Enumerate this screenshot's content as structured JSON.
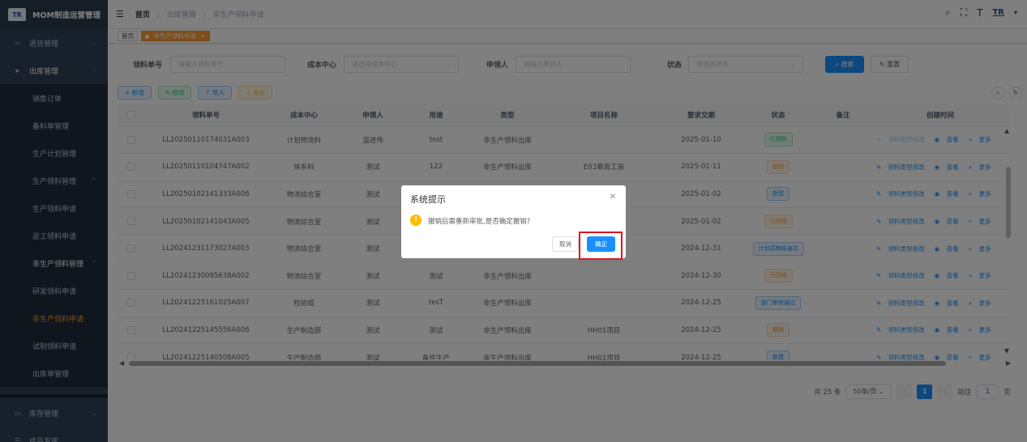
{
  "app": {
    "title": "MOM制造运营管理",
    "logo_text": "TR"
  },
  "sidebar": {
    "items": [
      {
        "label": "退货管理",
        "icon": "return-icon",
        "level": 1
      },
      {
        "label": "出库管理",
        "icon": "send-icon",
        "level": 1
      },
      {
        "label": "销售订单",
        "level": 2
      },
      {
        "label": "备料单管理",
        "level": 2
      },
      {
        "label": "生产计划管理",
        "level": 2
      },
      {
        "label": "生产领料管理",
        "level": 2
      },
      {
        "label": "生产领料申请",
        "level": 3
      },
      {
        "label": "返工领料申请",
        "level": 3
      },
      {
        "label": "非生产领料管理",
        "level": 2
      },
      {
        "label": "研发领料申请",
        "level": 3
      },
      {
        "label": "非生产领料申请",
        "level": 3
      },
      {
        "label": "试制领料申请",
        "level": 3
      },
      {
        "label": "出库单管理",
        "level": 2
      },
      {
        "label": "库存管理",
        "icon": "monitor-icon",
        "level": 1
      },
      {
        "label": "成品发库",
        "icon": "list-icon",
        "level": 1
      }
    ]
  },
  "breadcrumb": {
    "home": "首页",
    "sep": "/",
    "level1": "出库管理",
    "level2": "非生产领料申请"
  },
  "nav_logo": "TR",
  "tags": {
    "home": "首页",
    "active": "非生产领料申请",
    "close": "×"
  },
  "filter": {
    "order_no_label": "领料单号",
    "order_no_placeholder": "请输入领料单号",
    "cost_center_label": "成本中心",
    "cost_center_placeholder": "请选择成本中心",
    "applicant_label": "申领人",
    "applicant_placeholder": "请输入申领人",
    "status_label": "状态",
    "status_placeholder": "请选择状态",
    "search_label": "搜索",
    "reset_label": "重置"
  },
  "toolbar": {
    "add": "+ 新增",
    "edit": "修改",
    "import": "导入",
    "export": "导出"
  },
  "table": {
    "headers": [
      "领料单号",
      "成本中心",
      "申领人",
      "用途",
      "类型",
      "项目名称",
      "要求交期",
      "状态",
      "备注",
      "创建时间"
    ],
    "rows": [
      {
        "no": "LL20250110174031A003",
        "center": "计划物流科",
        "applicant": "温进伟",
        "purpose": "test",
        "type": "非生产领料出库",
        "project": "",
        "date": "2025-01-10",
        "status": "已到料",
        "status_color": "green",
        "edit_disabled": true
      },
      {
        "no": "LL20250110104747A002",
        "center": "体系科",
        "applicant": "测试",
        "purpose": "122",
        "type": "非生产领料出库",
        "project": "E03靠背工装",
        "date": "2025-01-11",
        "status": "撤销",
        "status_color": "orange",
        "edit_disabled": false
      },
      {
        "no": "LL20250102141333A006",
        "center": "物流综合室",
        "applicant": "测试",
        "purpose": "",
        "type": "",
        "project": "",
        "date": "2025-01-02",
        "status": "新建",
        "status_color": "blue",
        "edit_disabled": false
      },
      {
        "no": "LL20250102141043A005",
        "center": "物流综合室",
        "applicant": "测试",
        "purpose": "",
        "type": "",
        "project": "",
        "date": "2025-01-02",
        "status": "已冻结",
        "status_color": "orange",
        "edit_disabled": false
      },
      {
        "no": "LL20241231173027A003",
        "center": "物流综合室",
        "applicant": "测试",
        "purpose": "",
        "type": "",
        "project": "",
        "date": "2024-12-31",
        "status": "计划员审核通过",
        "status_color": "blue",
        "edit_disabled": false
      },
      {
        "no": "LL20241230095638A002",
        "center": "物流综合室",
        "applicant": "测试",
        "purpose": "测试",
        "type": "非生产领料出库",
        "project": "",
        "date": "2024-12-30",
        "status": "已冻结",
        "status_color": "orange",
        "edit_disabled": false
      },
      {
        "no": "LL20241225161025A007",
        "center": "检验组",
        "applicant": "测试",
        "purpose": "tesT",
        "type": "非生产领料出库",
        "project": "",
        "date": "2024-12-25",
        "status": "部门审核通过",
        "status_color": "blue",
        "edit_disabled": false
      },
      {
        "no": "LL20241225145556A006",
        "center": "生产制造部",
        "applicant": "测试",
        "purpose": "测试",
        "type": "非生产领料出库",
        "project": "HH01项目",
        "date": "2024-12-25",
        "status": "撤销",
        "status_color": "orange",
        "edit_disabled": false
      },
      {
        "no": "LL20241225140508A005",
        "center": "生产制造部",
        "applicant": "测试",
        "purpose": "备件生产",
        "type": "非生产领料出库",
        "project": "HH01项目",
        "date": "2024-12-25",
        "status": "新建",
        "status_color": "blue",
        "edit_disabled": false
      }
    ],
    "ops": {
      "type_edit": "领料类型修改",
      "view": "查看",
      "more": "更多"
    }
  },
  "pagination": {
    "total": "共 25 条",
    "page_size": "50条/页",
    "current": "1",
    "goto": "前往",
    "goto_value": "1",
    "page_unit": "页"
  },
  "dialog": {
    "title": "系统提示",
    "message": "撤销后需重新审批,是否确定撤销?",
    "cancel": "取消",
    "confirm": "确定"
  },
  "colors": {
    "accent": "#1890ff",
    "sidebar_bg": "#304156",
    "active_menu": "#ff9a2e",
    "highlight": "#e0141e"
  }
}
